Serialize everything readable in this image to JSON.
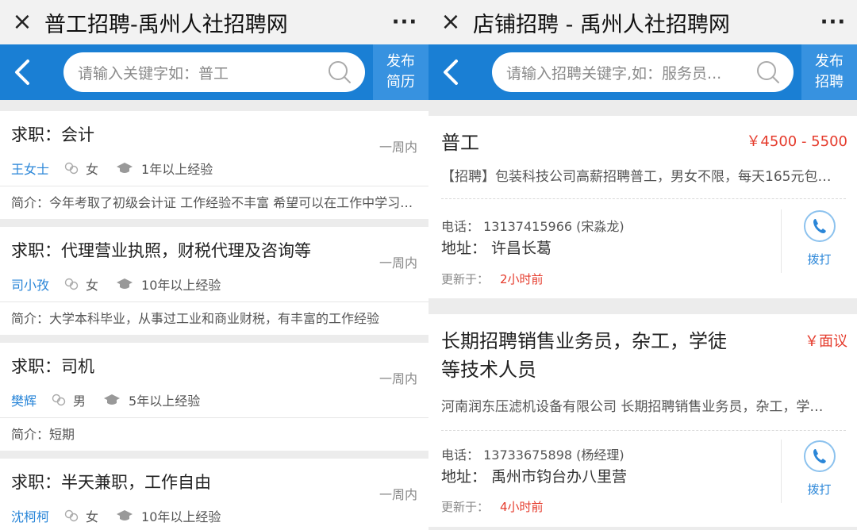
{
  "left": {
    "window_title": "普工招聘-禹州人社招聘网",
    "close_glyph": "×",
    "more_glyph": "···",
    "search_placeholder": "请输入关键字如：普工",
    "publish_line1": "发布",
    "publish_line2": "简历",
    "listings": [
      {
        "job": "求职：会计",
        "when": "一周内",
        "name": "王女士",
        "gender": "女",
        "experience": "1年以上经验",
        "intro": "简介：今年考取了初级会计证 工作经验不丰富 希望可以在工作中学习…"
      },
      {
        "job": "求职：代理营业执照，财税代理及咨询等",
        "when": "一周内",
        "name": "司小孜",
        "gender": "女",
        "experience": "10年以上经验",
        "intro": "简介：大学本科毕业，从事过工业和商业财税，有丰富的工作经验"
      },
      {
        "job": "求职：司机",
        "when": "一周内",
        "name": "樊辉",
        "gender": "男",
        "experience": "5年以上经验",
        "intro": "简介：短期"
      },
      {
        "job": "求职：半天兼职，工作自由",
        "when": "一周内",
        "name": "沈柯柯",
        "gender": "女",
        "experience": "10年以上经验",
        "intro": ""
      }
    ]
  },
  "right": {
    "window_title": "店铺招聘 - 禹州人社招聘网",
    "close_glyph": "×",
    "more_glyph": "···",
    "search_placeholder": "请输入招聘关键字,如：服务员...",
    "publish_line1": "发布",
    "publish_line2": "招聘",
    "jobs": [
      {
        "title_line1": "普工",
        "title_line2": "",
        "salary": "￥4500 - 5500",
        "desc": "【招聘】包装科技公司高薪招聘普工，男女不限，每天165元包…",
        "phone": "电话：  13137415966 (宋淼龙)",
        "address": "地址：  许昌长葛",
        "updated_label": "更新于：",
        "updated_value": "2小时前",
        "call_label": "拨打"
      },
      {
        "title_line1": "长期招聘销售业务员，杂工，学徒",
        "title_line2": "等技术人员",
        "salary": "￥面议",
        "desc": "河南润东压滤机设备有限公司 长期招聘销售业务员，杂工，学…",
        "phone": "电话：  13733675898 (杨经理)",
        "address": "地址：  禹州市钧台办八里营",
        "updated_label": "更新于：",
        "updated_value": "4小时前",
        "call_label": "拨打"
      }
    ]
  },
  "colors": {
    "brand_blue": "#1a7fd4",
    "publish_blue": "#3792e0",
    "name_blue": "#2a86d8",
    "salary_red": "#e53b2c"
  },
  "icons": [
    "close-icon",
    "more-icon",
    "back-icon",
    "search-icon",
    "gender-icon",
    "graduation-cap-icon",
    "phone-icon"
  ]
}
